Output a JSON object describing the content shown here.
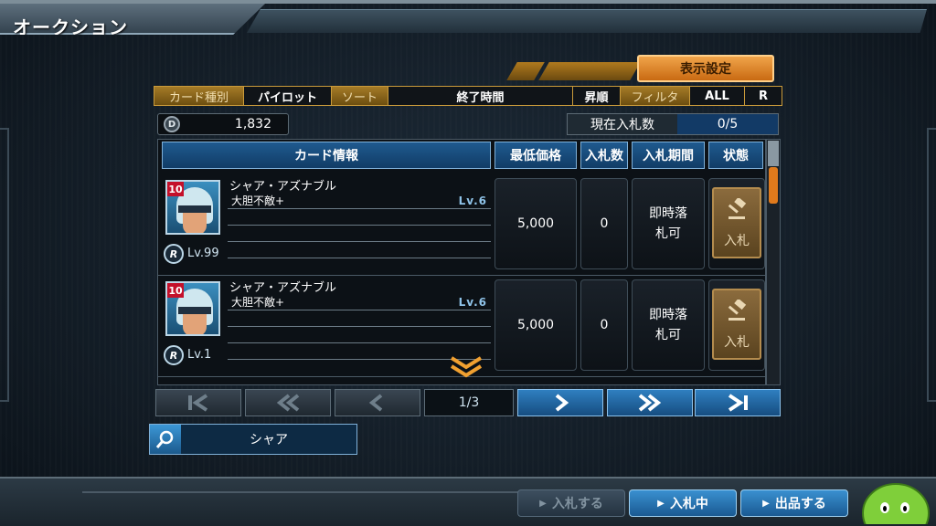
{
  "header": {
    "title": "オークション"
  },
  "display_settings": {
    "label": "表示設定"
  },
  "filters": [
    {
      "label": "カード種別",
      "value": "パイロット"
    },
    {
      "label": "ソート",
      "value": "終了時間"
    },
    {
      "label": "昇順"
    },
    {
      "label": "フィルタ",
      "value": "ALL"
    },
    {
      "label": "R"
    }
  ],
  "currency": {
    "icon": "D",
    "value": "1,832"
  },
  "bid_count": {
    "label": "現在入札数",
    "value": "0/5"
  },
  "table": {
    "headers": {
      "card_info": "カード情報",
      "min_price": "最低価格",
      "bids": "入札数",
      "period": "入札期間",
      "status": "状態"
    },
    "rows": [
      {
        "rarity": "10",
        "rank_icon": "R",
        "level": "Lv.99",
        "name": "シャア・アズナブル",
        "skill": "大胆不敵+",
        "skill_level": "Lv.6",
        "min_price": "5,000",
        "bids": "0",
        "period": "即時落札可",
        "bid_button": "入札"
      },
      {
        "rarity": "10",
        "rank_icon": "R",
        "level": "Lv.1",
        "name": "シャア・アズナブル",
        "skill": "大胆不敵+",
        "skill_level": "Lv.6",
        "min_price": "5,000",
        "bids": "0",
        "period": "即時落札可",
        "bid_button": "入札"
      }
    ]
  },
  "pagination": {
    "current": "1/3"
  },
  "search": {
    "value": "シャア"
  },
  "bottom_buttons": [
    {
      "label": "入札する",
      "state": "disabled"
    },
    {
      "label": "入札中",
      "state": "active"
    },
    {
      "label": "出品する",
      "state": "active"
    }
  ]
}
